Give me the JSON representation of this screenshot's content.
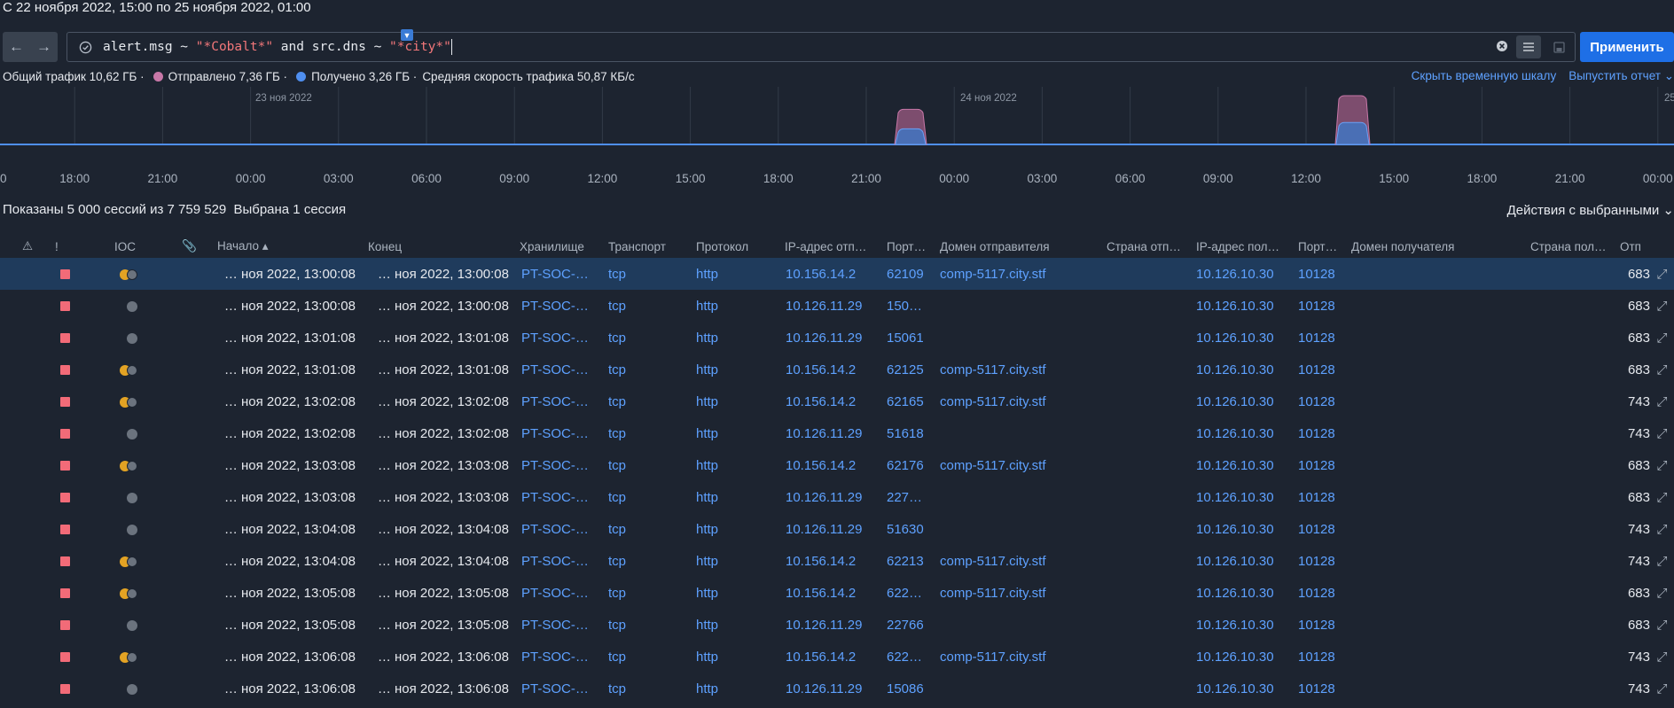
{
  "header": {
    "time_range": "С 22 ноября 2022, 15:00 по 25 ноября 2022, 01:00"
  },
  "query": {
    "back_icon": "arrow-left-icon",
    "forward_icon": "arrow-right-icon",
    "filter_icon": "check-circle-icon",
    "part1": "alert.msg ~ ",
    "str1": "\"*Cobalt*\"",
    "part2": " and src.dns ~ ",
    "str2": "\"*city*\"",
    "clear_icon": "clear-icon",
    "apply_label": "Применить"
  },
  "stats": {
    "total": "Общий трафик 10,62 ГБ ·",
    "sent": "Отправлено 7,36 ГБ ·",
    "received": "Получено 3,26 ГБ ·",
    "speed": "Средняя скорость трафика 50,87 КБ/с",
    "sent_color": "#c878a8",
    "received_color": "#4f8ff0",
    "hide_timeline": "Скрыть временную шкалу",
    "export_report": "Выпустить отчет"
  },
  "chart_data": {
    "type": "area",
    "date_labels": [
      "23 ноя 2022",
      "24 ноя 2022",
      "25"
    ],
    "tick_labels": [
      "0",
      "18:00",
      "21:00",
      "00:00",
      "03:00",
      "06:00",
      "09:00",
      "12:00",
      "15:00",
      "18:00",
      "21:00",
      "00:00",
      "03:00",
      "06:00",
      "09:00",
      "12:00",
      "15:00",
      "18:00",
      "21:00",
      "00:00"
    ],
    "series": [
      {
        "name": "Отправлено",
        "color": "#c878a8"
      },
      {
        "name": "Получено",
        "color": "#4f8ff0"
      }
    ],
    "spikes": [
      {
        "start": "23 ноя 22:00",
        "end": "23 ноя 23:00",
        "sent": 0.72,
        "received": 0.32
      },
      {
        "start": "24 ноя 13:00",
        "end": "24 ноя 14:00",
        "sent": 1.0,
        "received": 0.45
      }
    ]
  },
  "sessions": {
    "shown": "Показаны 5 000 сессий из 7 759 529",
    "selected": "Выбрана 1 сессия",
    "actions": "Действия с выбранными ⌄"
  },
  "table": {
    "headers": [
      "⚠",
      "!",
      "IOC",
      "📎",
      "Начало ▴",
      "Конец",
      "Хранилище",
      "Транспорт",
      "Протокол",
      "IP-адрес отп…",
      "Порт…",
      "Домен отправителя",
      "Страна отп…",
      "IP-адрес пол…",
      "Порт…",
      "Домен получателя",
      "Страна пол…",
      "Отп",
      ""
    ],
    "rows": [
      {
        "ioc": "two",
        "start": "… ноя 2022, 13:00:08",
        "end": "… ноя 2022, 13:00:08",
        "storage": "PT-SOC-…",
        "transport": "tcp",
        "protocol": "http",
        "src_ip": "10.156.14.2",
        "src_port": "62109",
        "src_dns": "comp-5117.city.stf",
        "dst_ip": "10.126.10.30",
        "dst_port": "10128",
        "sent": "683",
        "selected": true
      },
      {
        "ioc": "one",
        "start": "… ноя 2022, 13:00:08",
        "end": "… ноя 2022, 13:00:08",
        "storage": "PT-SOC-…",
        "transport": "tcp",
        "protocol": "http",
        "src_ip": "10.126.11.29",
        "src_port": "150…",
        "src_dns": "",
        "dst_ip": "10.126.10.30",
        "dst_port": "10128",
        "sent": "683"
      },
      {
        "ioc": "one",
        "start": "… ноя 2022, 13:01:08",
        "end": "… ноя 2022, 13:01:08",
        "storage": "PT-SOC-…",
        "transport": "tcp",
        "protocol": "http",
        "src_ip": "10.126.11.29",
        "src_port": "15061",
        "src_dns": "",
        "dst_ip": "10.126.10.30",
        "dst_port": "10128",
        "sent": "683"
      },
      {
        "ioc": "two",
        "start": "… ноя 2022, 13:01:08",
        "end": "… ноя 2022, 13:01:08",
        "storage": "PT-SOC-…",
        "transport": "tcp",
        "protocol": "http",
        "src_ip": "10.156.14.2",
        "src_port": "62125",
        "src_dns": "comp-5117.city.stf",
        "dst_ip": "10.126.10.30",
        "dst_port": "10128",
        "sent": "683"
      },
      {
        "ioc": "two",
        "start": "… ноя 2022, 13:02:08",
        "end": "… ноя 2022, 13:02:08",
        "storage": "PT-SOC-…",
        "transport": "tcp",
        "protocol": "http",
        "src_ip": "10.156.14.2",
        "src_port": "62165",
        "src_dns": "comp-5117.city.stf",
        "dst_ip": "10.126.10.30",
        "dst_port": "10128",
        "sent": "743"
      },
      {
        "ioc": "one",
        "start": "… ноя 2022, 13:02:08",
        "end": "… ноя 2022, 13:02:08",
        "storage": "PT-SOC-…",
        "transport": "tcp",
        "protocol": "http",
        "src_ip": "10.126.11.29",
        "src_port": "51618",
        "src_dns": "",
        "dst_ip": "10.126.10.30",
        "dst_port": "10128",
        "sent": "743"
      },
      {
        "ioc": "two",
        "start": "… ноя 2022, 13:03:08",
        "end": "… ноя 2022, 13:03:08",
        "storage": "PT-SOC-…",
        "transport": "tcp",
        "protocol": "http",
        "src_ip": "10.156.14.2",
        "src_port": "62176",
        "src_dns": "comp-5117.city.stf",
        "dst_ip": "10.126.10.30",
        "dst_port": "10128",
        "sent": "683"
      },
      {
        "ioc": "one",
        "start": "… ноя 2022, 13:03:08",
        "end": "… ноя 2022, 13:03:08",
        "storage": "PT-SOC-…",
        "transport": "tcp",
        "protocol": "http",
        "src_ip": "10.126.11.29",
        "src_port": "227…",
        "src_dns": "",
        "dst_ip": "10.126.10.30",
        "dst_port": "10128",
        "sent": "683"
      },
      {
        "ioc": "one",
        "start": "… ноя 2022, 13:04:08",
        "end": "… ноя 2022, 13:04:08",
        "storage": "PT-SOC-…",
        "transport": "tcp",
        "protocol": "http",
        "src_ip": "10.126.11.29",
        "src_port": "51630",
        "src_dns": "",
        "dst_ip": "10.126.10.30",
        "dst_port": "10128",
        "sent": "743"
      },
      {
        "ioc": "two",
        "start": "… ноя 2022, 13:04:08",
        "end": "… ноя 2022, 13:04:08",
        "storage": "PT-SOC-…",
        "transport": "tcp",
        "protocol": "http",
        "src_ip": "10.156.14.2",
        "src_port": "62213",
        "src_dns": "comp-5117.city.stf",
        "dst_ip": "10.126.10.30",
        "dst_port": "10128",
        "sent": "743"
      },
      {
        "ioc": "two",
        "start": "… ноя 2022, 13:05:08",
        "end": "… ноя 2022, 13:05:08",
        "storage": "PT-SOC-…",
        "transport": "tcp",
        "protocol": "http",
        "src_ip": "10.156.14.2",
        "src_port": "622…",
        "src_dns": "comp-5117.city.stf",
        "dst_ip": "10.126.10.30",
        "dst_port": "10128",
        "sent": "683"
      },
      {
        "ioc": "one",
        "start": "… ноя 2022, 13:05:08",
        "end": "… ноя 2022, 13:05:08",
        "storage": "PT-SOC-…",
        "transport": "tcp",
        "protocol": "http",
        "src_ip": "10.126.11.29",
        "src_port": "22766",
        "src_dns": "",
        "dst_ip": "10.126.10.30",
        "dst_port": "10128",
        "sent": "683"
      },
      {
        "ioc": "two",
        "start": "… ноя 2022, 13:06:08",
        "end": "… ноя 2022, 13:06:08",
        "storage": "PT-SOC-…",
        "transport": "tcp",
        "protocol": "http",
        "src_ip": "10.156.14.2",
        "src_port": "622…",
        "src_dns": "comp-5117.city.stf",
        "dst_ip": "10.126.10.30",
        "dst_port": "10128",
        "sent": "743"
      },
      {
        "ioc": "one",
        "start": "… ноя 2022, 13:06:08",
        "end": "… ноя 2022, 13:06:08",
        "storage": "PT-SOC-…",
        "transport": "tcp",
        "protocol": "http",
        "src_ip": "10.126.11.29",
        "src_port": "15086",
        "src_dns": "",
        "dst_ip": "10.126.10.30",
        "dst_port": "10128",
        "sent": "743"
      }
    ]
  }
}
